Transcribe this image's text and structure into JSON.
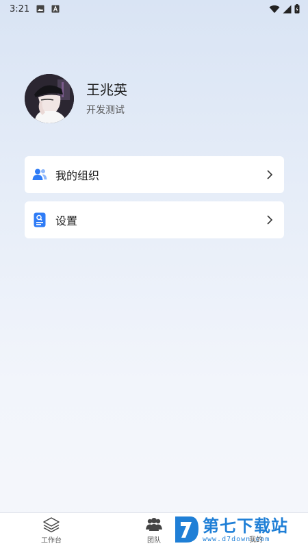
{
  "status_bar": {
    "time": "3:21",
    "icons": [
      "image-notification-icon",
      "a-notification-icon",
      "wifi-icon",
      "signal-icon",
      "battery-icon"
    ]
  },
  "profile": {
    "name": "王兆英",
    "role": "开发测试"
  },
  "menu": [
    {
      "label": "我的组织",
      "icon": "group-icon",
      "color": "#2f7cf6"
    },
    {
      "label": "设置",
      "icon": "settings-doc-icon",
      "color": "#2f7cf6"
    }
  ],
  "tabbar": {
    "tabs": [
      {
        "label": "工作台",
        "icon": "layers-icon"
      },
      {
        "label": "团队",
        "icon": "team-icon"
      },
      {
        "label": "我的",
        "icon": "me-icon"
      }
    ]
  },
  "watermark": {
    "cn": "第七下载站",
    "url": "www.d7down.com"
  },
  "colors": {
    "accent": "#2f7cf6",
    "watermark": "#1f7fd6"
  }
}
